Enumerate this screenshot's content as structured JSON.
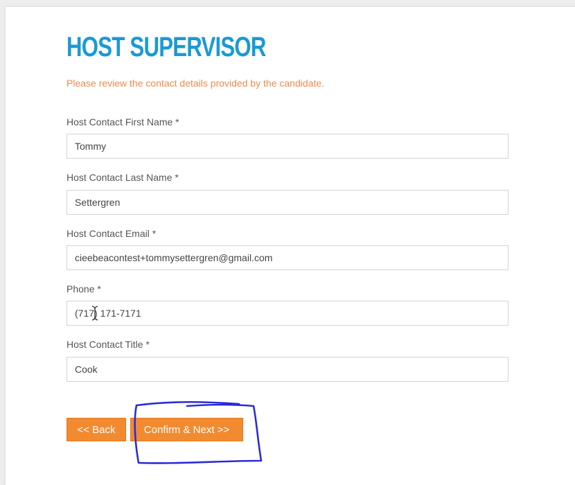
{
  "form": {
    "title": "HOST SUPERVISOR",
    "instructions": "Please review the contact details provided by the candidate.",
    "fields": [
      {
        "label": "Host Contact First Name *",
        "value": "Tommy"
      },
      {
        "label": "Host Contact Last Name *",
        "value": "Settergren"
      },
      {
        "label": "Host Contact Email *",
        "value": "cieebeacontest+tommysettergren@gmail.com"
      },
      {
        "label": "Phone *",
        "value": "(717) 171-7171"
      },
      {
        "label": "Host Contact Title *",
        "value": "Cook"
      }
    ]
  },
  "buttons": {
    "back_label": "<< Back",
    "next_label": "Confirm & Next >>"
  },
  "colors": {
    "title": "#1a9ad3",
    "instructions": "#f08a4b",
    "button": "#f28b30",
    "annotation": "#2b2bd6"
  },
  "icons": {
    "cursor": "text-cursor-icon"
  }
}
